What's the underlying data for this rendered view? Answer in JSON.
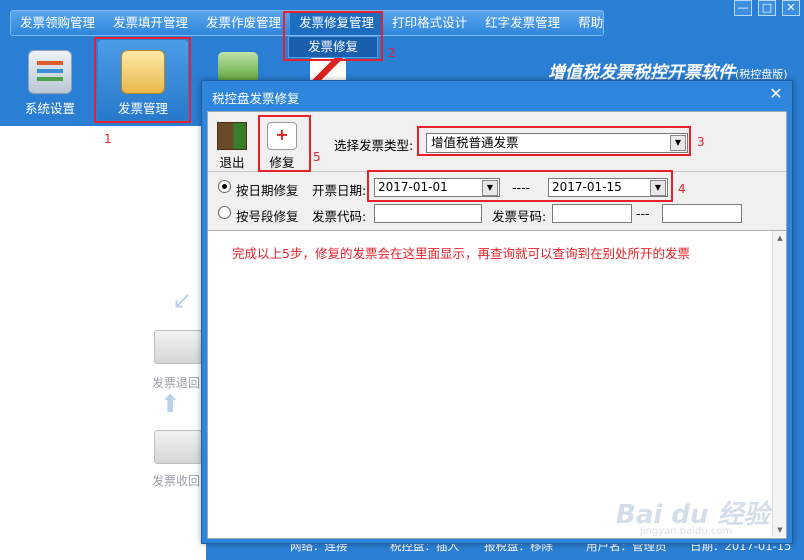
{
  "menu": {
    "items": [
      "发票领购管理",
      "发票填开管理",
      "发票作废管理",
      "发票修复管理",
      "打印格式设计",
      "红字发票管理",
      "帮助"
    ],
    "dropdown_item": "发票修复"
  },
  "window_controls": {
    "minimize": "—",
    "maximize": "□",
    "close": "✕"
  },
  "brand": {
    "title": "增值税发票税控开票软件",
    "suffix": "(税控盘版)"
  },
  "toolbar": {
    "system_settings": "系统设置",
    "invoice_management": "发票管理"
  },
  "left_pane": {
    "return_label": "发票退回",
    "recover_label": "发票收回"
  },
  "status_bar": {
    "network": "网络：连接",
    "tax_disk": "税控盘：插入",
    "report_disk": "报税盘：移除",
    "user": "用户名：管理员",
    "date": "日期：2017-01-15"
  },
  "dialog": {
    "title": "税控盘发票修复",
    "close": "✕",
    "exit_label": "退出",
    "repair_label": "修复",
    "type_label": "选择发票类型:",
    "type_value": "增值税普通发票",
    "by_date_label": "按日期修复",
    "date_label": "开票日期:",
    "date_from": "2017-01-01",
    "date_sep": "----",
    "date_to": "2017-01-15",
    "by_segment_label": "按号段修复",
    "code_label": "发票代码:",
    "number_label": "发票号码:",
    "number_sep": "---",
    "message": "完成以上5步，修复的发票会在这里面显示，再查询就可以查询到在别处所开的发票"
  },
  "annotations": [
    "1",
    "2",
    "3",
    "4",
    "5"
  ],
  "watermark": {
    "text": "Bai du 经验",
    "url": "jingyan.baidu.com"
  },
  "colors": {
    "accent": "#2a7fd4",
    "annotation": "#e8202a"
  }
}
